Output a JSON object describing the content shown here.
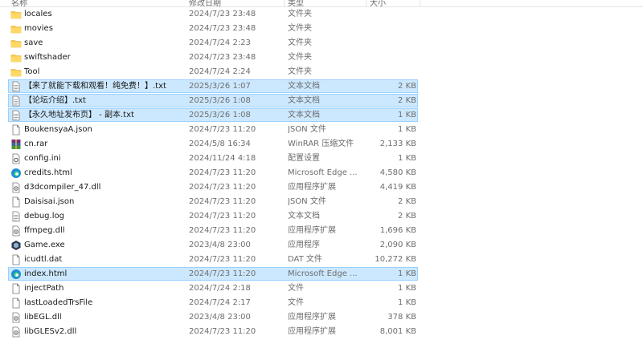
{
  "columns": {
    "name": "名称",
    "date": "修改日期",
    "type": "类型",
    "size": "大小"
  },
  "rows": [
    {
      "name": "locales",
      "date": "2024/7/23 23:48",
      "type": "文件夹",
      "size": "",
      "icon": "folder-icon",
      "selected": false
    },
    {
      "name": "movies",
      "date": "2024/7/23 23:48",
      "type": "文件夹",
      "size": "",
      "icon": "folder-icon",
      "selected": false
    },
    {
      "name": "save",
      "date": "2024/7/24 2:23",
      "type": "文件夹",
      "size": "",
      "icon": "folder-icon",
      "selected": false
    },
    {
      "name": "swiftshader",
      "date": "2024/7/23 23:48",
      "type": "文件夹",
      "size": "",
      "icon": "folder-icon",
      "selected": false
    },
    {
      "name": "Tool",
      "date": "2024/7/24 2:24",
      "type": "文件夹",
      "size": "",
      "icon": "folder-icon",
      "selected": false
    },
    {
      "name": "【来了就能下载和观看！纯免费！】.txt",
      "date": "2025/3/26 1:07",
      "type": "文本文档",
      "size": "2 KB",
      "icon": "text-file-icon",
      "selected": true
    },
    {
      "name": "【论坛介绍】.txt",
      "date": "2025/3/26 1:08",
      "type": "文本文档",
      "size": "2 KB",
      "icon": "text-file-icon",
      "selected": true
    },
    {
      "name": "【永久地址发布页】 - 副本.txt",
      "date": "2025/3/26 1:08",
      "type": "文本文档",
      "size": "1 KB",
      "icon": "text-file-icon",
      "selected": true
    },
    {
      "name": "BoukensyaA.json",
      "date": "2024/7/23 11:20",
      "type": "JSON 文件",
      "size": "1 KB",
      "icon": "file-icon",
      "selected": false
    },
    {
      "name": "cn.rar",
      "date": "2024/5/8 16:34",
      "type": "WinRAR 压缩文件",
      "size": "2,133 KB",
      "icon": "winrar-icon",
      "selected": false
    },
    {
      "name": "config.ini",
      "date": "2024/11/24 4:18",
      "type": "配置设置",
      "size": "1 KB",
      "icon": "settings-file-icon",
      "selected": false
    },
    {
      "name": "credits.html",
      "date": "2024/7/23 11:20",
      "type": "Microsoft Edge ...",
      "size": "4,580 KB",
      "icon": "edge-icon",
      "selected": false
    },
    {
      "name": "d3dcompiler_47.dll",
      "date": "2024/7/23 11:20",
      "type": "应用程序扩展",
      "size": "4,419 KB",
      "icon": "dll-icon",
      "selected": false
    },
    {
      "name": "Daisisai.json",
      "date": "2024/7/23 11:20",
      "type": "JSON 文件",
      "size": "2 KB",
      "icon": "file-icon",
      "selected": false
    },
    {
      "name": "debug.log",
      "date": "2024/7/23 11:20",
      "type": "文本文档",
      "size": "2 KB",
      "icon": "text-file-icon",
      "selected": false
    },
    {
      "name": "ffmpeg.dll",
      "date": "2024/7/23 11:20",
      "type": "应用程序扩展",
      "size": "1,696 KB",
      "icon": "dll-icon",
      "selected": false
    },
    {
      "name": "Game.exe",
      "date": "2023/4/8 23:00",
      "type": "应用程序",
      "size": "2,090 KB",
      "icon": "game-exe-icon",
      "selected": false
    },
    {
      "name": "icudtl.dat",
      "date": "2024/7/23 11:20",
      "type": "DAT 文件",
      "size": "10,272 KB",
      "icon": "file-icon",
      "selected": false
    },
    {
      "name": "index.html",
      "date": "2024/7/23 11:20",
      "type": "Microsoft Edge ...",
      "size": "1 KB",
      "icon": "edge-icon",
      "selected": true
    },
    {
      "name": "injectPath",
      "date": "2024/7/24 2:18",
      "type": "文件",
      "size": "1 KB",
      "icon": "file-icon",
      "selected": false
    },
    {
      "name": "lastLoadedTrsFile",
      "date": "2024/7/24 2:17",
      "type": "文件",
      "size": "1 KB",
      "icon": "file-icon",
      "selected": false
    },
    {
      "name": "libEGL.dll",
      "date": "2023/4/8 23:00",
      "type": "应用程序扩展",
      "size": "378 KB",
      "icon": "dll-icon",
      "selected": false
    },
    {
      "name": "libGLESv2.dll",
      "date": "2024/7/23 11:20",
      "type": "应用程序扩展",
      "size": "8,001 KB",
      "icon": "dll-icon",
      "selected": false
    }
  ],
  "colors": {
    "selection": "#cce8ff",
    "selection_border": "#99d1ff",
    "folder": "#f8c948",
    "edge": "#1b8fd8"
  }
}
